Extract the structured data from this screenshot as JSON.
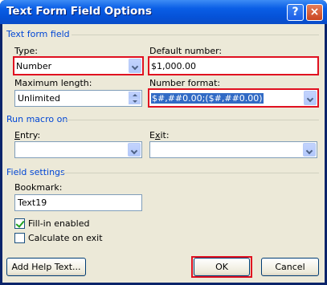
{
  "window": {
    "title": "Text Form Field Options",
    "help_glyph": "?",
    "close_glyph": "×"
  },
  "text_form_field": {
    "section_label": "Text form field",
    "type_label": "Type:",
    "type_value": "Number",
    "default_number_label": "Default number:",
    "default_number_value": "$1,000.00",
    "max_length_label": "Maximum length:",
    "max_length_value": "Unlimited",
    "number_format_label": "Number format:",
    "number_format_value": "$#,##0.00;($#,##0.00)"
  },
  "run_macro": {
    "section_label": "Run macro on",
    "entry_label": "Entry:",
    "entry_value": "",
    "exit_label": "Exit:",
    "exit_value": ""
  },
  "field_settings": {
    "section_label": "Field settings",
    "bookmark_label": "Bookmark:",
    "bookmark_value": "Text19",
    "fill_in_label": "Fill-in enabled",
    "fill_in_checked": true,
    "calculate_label": "Calculate on exit",
    "calculate_checked": false
  },
  "buttons": {
    "add_help": "Add Help Text...",
    "ok": "OK",
    "cancel": "Cancel"
  },
  "colors": {
    "section": "#0046d5",
    "highlight": "#e01020",
    "title_bar": "#0552d8",
    "face": "#ece9d8"
  }
}
